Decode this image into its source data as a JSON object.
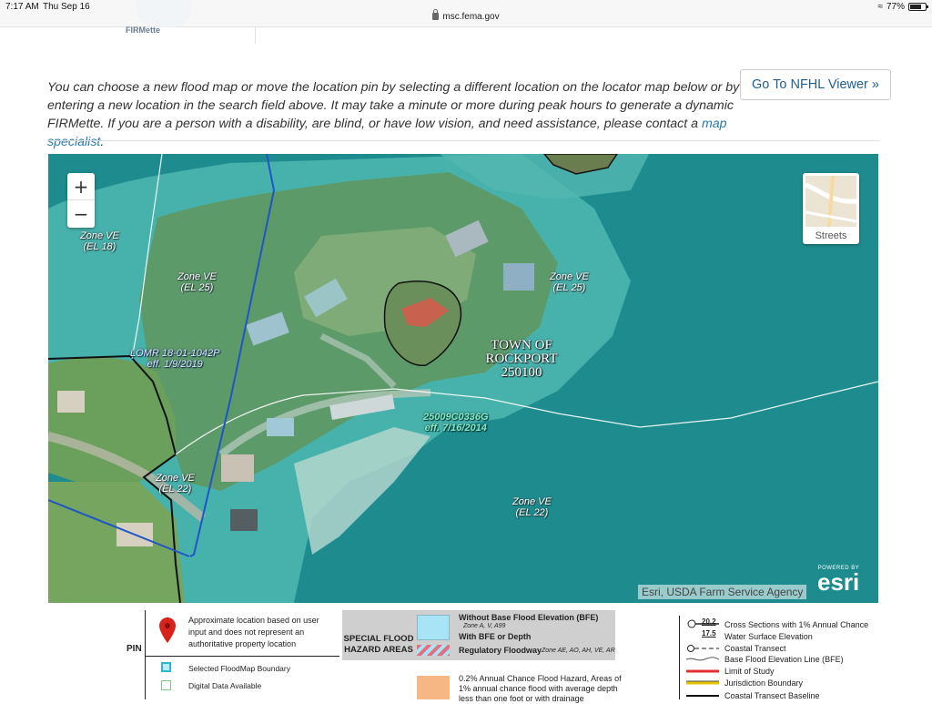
{
  "status_bar": {
    "time": "7:17 AM",
    "date": "Thu Sep 16",
    "url": "msc.fema.gov",
    "battery": "77%"
  },
  "header": {
    "logo_text": "FIRMette"
  },
  "intro": {
    "text": "You can choose a new flood map or move the location pin by selecting a different location on the locator map below or by entering a new location in the search field above. It may take a minute or more during peak hours to generate a dynamic FIRMette. If you are a person with a disability, are blind, or have low vision, and need assistance, please contact a ",
    "link_text": "map specialist",
    "end": "."
  },
  "nfhl_button": {
    "label": "Go To NFHL Viewer »"
  },
  "map": {
    "zoom_in": "+",
    "zoom_out": "−",
    "basemap_label": "Streets",
    "zones": [
      {
        "zone": "Zone VE",
        "el": "(EL 18)"
      },
      {
        "zone": "Zone VE",
        "el": "(EL 25)"
      },
      {
        "zone": "Zone VE",
        "el": "(EL 25)"
      },
      {
        "zone": "Zone VE",
        "el": "(EL 22)"
      },
      {
        "zone": "Zone VE",
        "el": "(EL 22)"
      }
    ],
    "lomr": {
      "line1": "LOMR 18-01-1042P",
      "line2": "eff. 1/9/2019"
    },
    "panel": {
      "line1": "25009C0336G",
      "line2": "eff. 7/16/2014"
    },
    "town": {
      "line1": "TOWN OF",
      "line2": "ROCKPORT",
      "line3": "250100"
    },
    "attribution": "Esri, USDA Farm Service Agency",
    "esri": {
      "powered_by": "POWERED BY",
      "logo": "esri"
    }
  },
  "legend": {
    "pin_label": "PIN",
    "pin_text": "Approximate location based on user input and does not represent an authoritative property location",
    "selected_boundary": "Selected FloodMap Boundary",
    "digital_data": "Digital Data Available",
    "sfha_title_1": "SPECIAL FLOOD",
    "sfha_title_2": "HAZARD AREAS",
    "without_bfe": "Without Base Flood Elevation (BFE)",
    "without_bfe_sub": "Zone A, V, A99",
    "with_bfe": "With BFE or Depth",
    "regulatory_floodway": "Regulatory Floodway",
    "regulatory_floodway_sub": "Zone AE, AO, AH, VE, AR",
    "annual_chance": "0.2% Annual Chance Flood Hazard, Areas of 1% annual chance flood with average depth less than one foot or with drainage",
    "right_items": [
      {
        "num": "20.2",
        "label": "Cross Sections with 1% Annual Chance"
      },
      {
        "num": "17.5",
        "label": "Water Surface Elevation"
      },
      {
        "num": "",
        "label": "Coastal Transect"
      },
      {
        "num": "",
        "label": "Base Flood Elevation Line (BFE)"
      },
      {
        "num": "",
        "label": "Limit of Study"
      },
      {
        "num": "",
        "label": "Jurisdiction Boundary"
      },
      {
        "num": "",
        "label": "Coastal Transect Baseline"
      }
    ],
    "colors": {
      "limit": "#e03030",
      "jurisdiction": "#e6c400"
    }
  }
}
